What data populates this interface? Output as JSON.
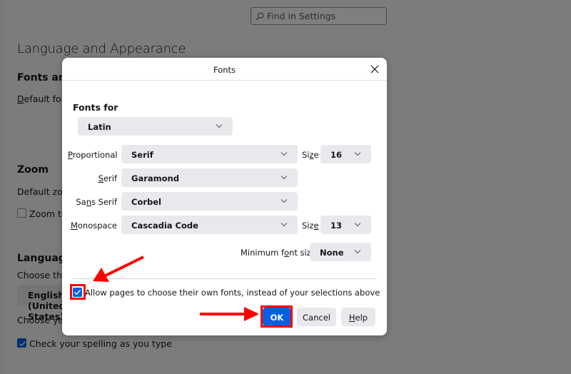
{
  "background": {
    "search": {
      "placeholder": "Find in Settings",
      "icon": "search-icon"
    },
    "section_title": "Language and Appearance",
    "fonts_heading": "Fonts and Colors",
    "default_font_label": "Default font",
    "zoom_heading": "Zoom",
    "default_zoom_label": "Default zoom",
    "zoom_text_only_label": "Zoom text only",
    "zoom_text_only_checked": false,
    "language_heading": "Language",
    "choose_language_label": "Choose the languages used to display menus, messages, and notifications",
    "language_select_value": "English (United States)",
    "choose_your_label": "Choose your preferred language for displaying pages",
    "spellcheck_label": "Check your spelling as you type",
    "spellcheck_checked": true
  },
  "dialog": {
    "title": "Fonts",
    "close_icon": "close-icon",
    "fonts_for_label": "Fonts for",
    "fonts_for_value": "Latin",
    "rows": [
      {
        "label": "Proportional",
        "value": "Serif",
        "size_label": "Size",
        "size_value": "16"
      },
      {
        "label": "Serif",
        "value": "Garamond"
      },
      {
        "label": "Sans Serif",
        "value": "Corbel"
      },
      {
        "label": "Monospace",
        "value": "Cascadia Code",
        "size_label": "Size",
        "size_value": "13"
      }
    ],
    "min_font_size_label": "Minimum font size",
    "min_font_size_value": "None",
    "allow_pages_label": "Allow pages to choose their own fonts, instead of your selections above",
    "allow_pages_checked": true,
    "buttons": {
      "ok": "OK",
      "cancel": "Cancel",
      "help": "Help"
    }
  },
  "annotations": {
    "color": "#ff0000",
    "highlights": [
      "allow-pages-checkbox",
      "ok-button"
    ]
  }
}
